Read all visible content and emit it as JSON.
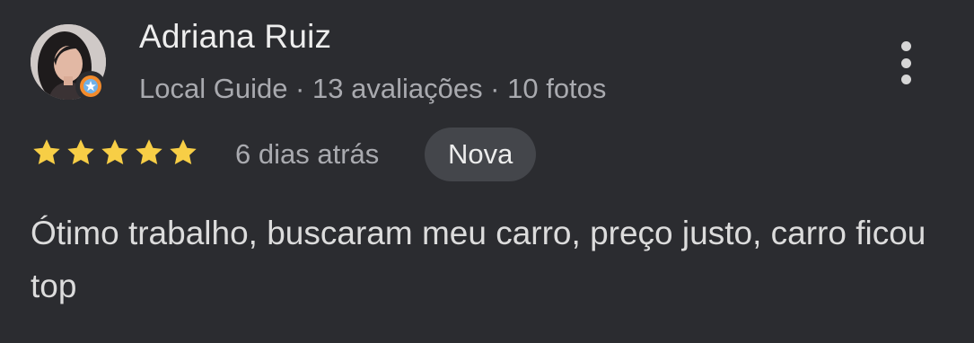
{
  "review": {
    "author_name": "Adriana Ruiz",
    "author_meta": "Local Guide · 13 avaliações · 10 fotos",
    "avatar_icon": "user-photo",
    "local_guide_icon": "local-guide-badge-icon",
    "more_icon": "more-vert-icon",
    "rating": 5,
    "rating_max": 5,
    "star_color": "#f7ce46",
    "time_ago": "6 dias atrás",
    "new_badge": "Nova",
    "text": "Ótimo trabalho, buscaram meu carro, preço justo, carro ficou top"
  },
  "colors": {
    "background": "#2b2c30",
    "badge_background": "#44464b",
    "secondary_text": "#a9aaaf",
    "local_guide_accent": "#f28b2c"
  }
}
